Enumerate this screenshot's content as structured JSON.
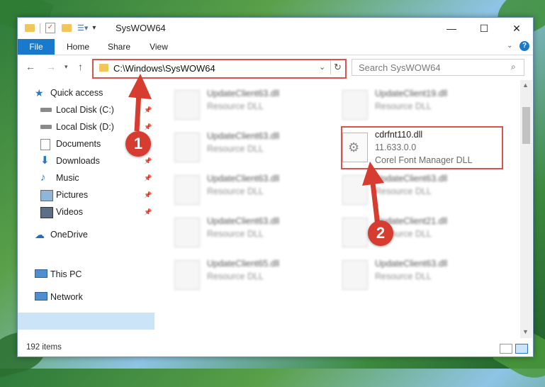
{
  "window": {
    "title": "SysWOW64",
    "controls": {
      "minimize": "—",
      "maximize": "☐",
      "close": "✕"
    }
  },
  "ribbon": {
    "tabs": [
      {
        "label": "File"
      },
      {
        "label": "Home"
      },
      {
        "label": "Share"
      },
      {
        "label": "View"
      }
    ],
    "help": "?"
  },
  "navigation": {
    "address": "C:\\Windows\\SysWOW64",
    "search_placeholder": "Search SysWOW64"
  },
  "sidebar": {
    "quick_access": "Quick access",
    "items": [
      {
        "label": "Local Disk (C:)",
        "icon": "drive-icon"
      },
      {
        "label": "Local Disk (D:)",
        "icon": "drive-icon"
      },
      {
        "label": "Documents",
        "icon": "documents-icon"
      },
      {
        "label": "Downloads",
        "icon": "downloads-icon"
      },
      {
        "label": "Music",
        "icon": "music-icon"
      },
      {
        "label": "Pictures",
        "icon": "pictures-icon"
      },
      {
        "label": "Videos",
        "icon": "videos-icon"
      }
    ],
    "onedrive": "OneDrive",
    "this_pc": "This PC",
    "network": "Network"
  },
  "files": {
    "left_column": [
      {
        "name": "UpdateClient63.dll",
        "desc": "Resource DLL"
      },
      {
        "name": "UpdateClient63.dll",
        "desc": "Resource DLL"
      },
      {
        "name": "UpdateClient63.dll",
        "desc": "Resource DLL"
      },
      {
        "name": "UpdateClient63.dll",
        "desc": "Resource DLL"
      },
      {
        "name": "UpdateClient65.dll",
        "desc": "Resource DLL"
      }
    ],
    "right_column": [
      {
        "name": "UpdateClient19.dll",
        "desc": "Resource DLL"
      },
      {
        "name": "UpdateClient63.dll",
        "desc": "Resource DLL"
      },
      {
        "name": "UpdateClient21.dll",
        "desc": "Resource DLL"
      },
      {
        "name": "UpdateClient63.dll",
        "desc": "Resource DLL"
      }
    ],
    "highlighted": {
      "name": "cdrfnt110.dll",
      "version": "11.633.0.0",
      "desc": "Corel Font Manager DLL"
    }
  },
  "status": {
    "item_count": "192 items"
  },
  "annotations": {
    "step1": "1",
    "step2": "2",
    "color": "#d63c2f"
  }
}
